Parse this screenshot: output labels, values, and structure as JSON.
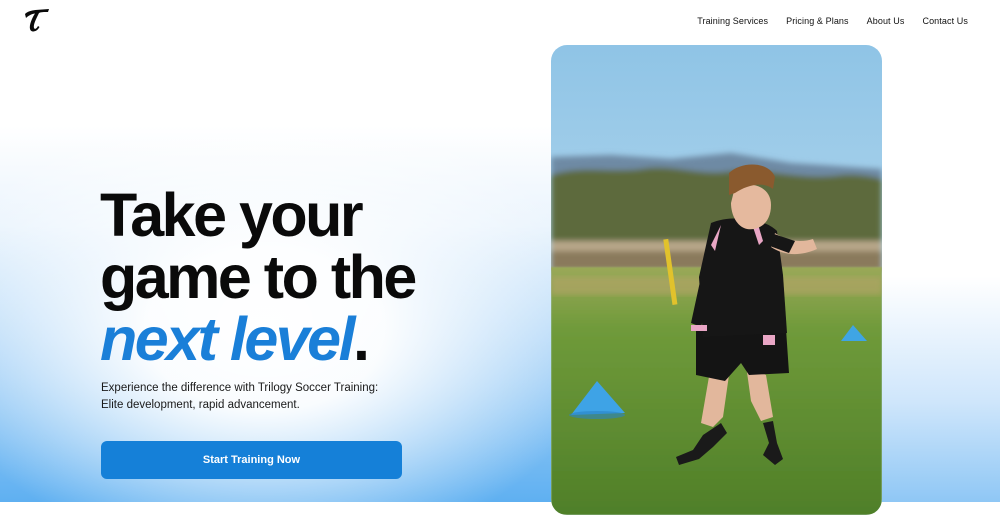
{
  "brand": {
    "logo_icon": "trilogy-t-logo-icon"
  },
  "nav": {
    "items": [
      {
        "label": "Training Services"
      },
      {
        "label": "Pricing & Plans"
      },
      {
        "label": "About Us"
      },
      {
        "label": "Contact Us"
      }
    ]
  },
  "hero": {
    "title_line1": "Take your",
    "title_line2": "game to the",
    "title_accent": "next level",
    "title_period": ".",
    "subtitle": "Experience the difference with Trilogy Soccer Training: Elite development, rapid advancement.",
    "cta_label": "Start Training Now"
  },
  "colors": {
    "accent": "#1a7fd8",
    "button": "#1580d8",
    "text": "#0a0a0a"
  }
}
